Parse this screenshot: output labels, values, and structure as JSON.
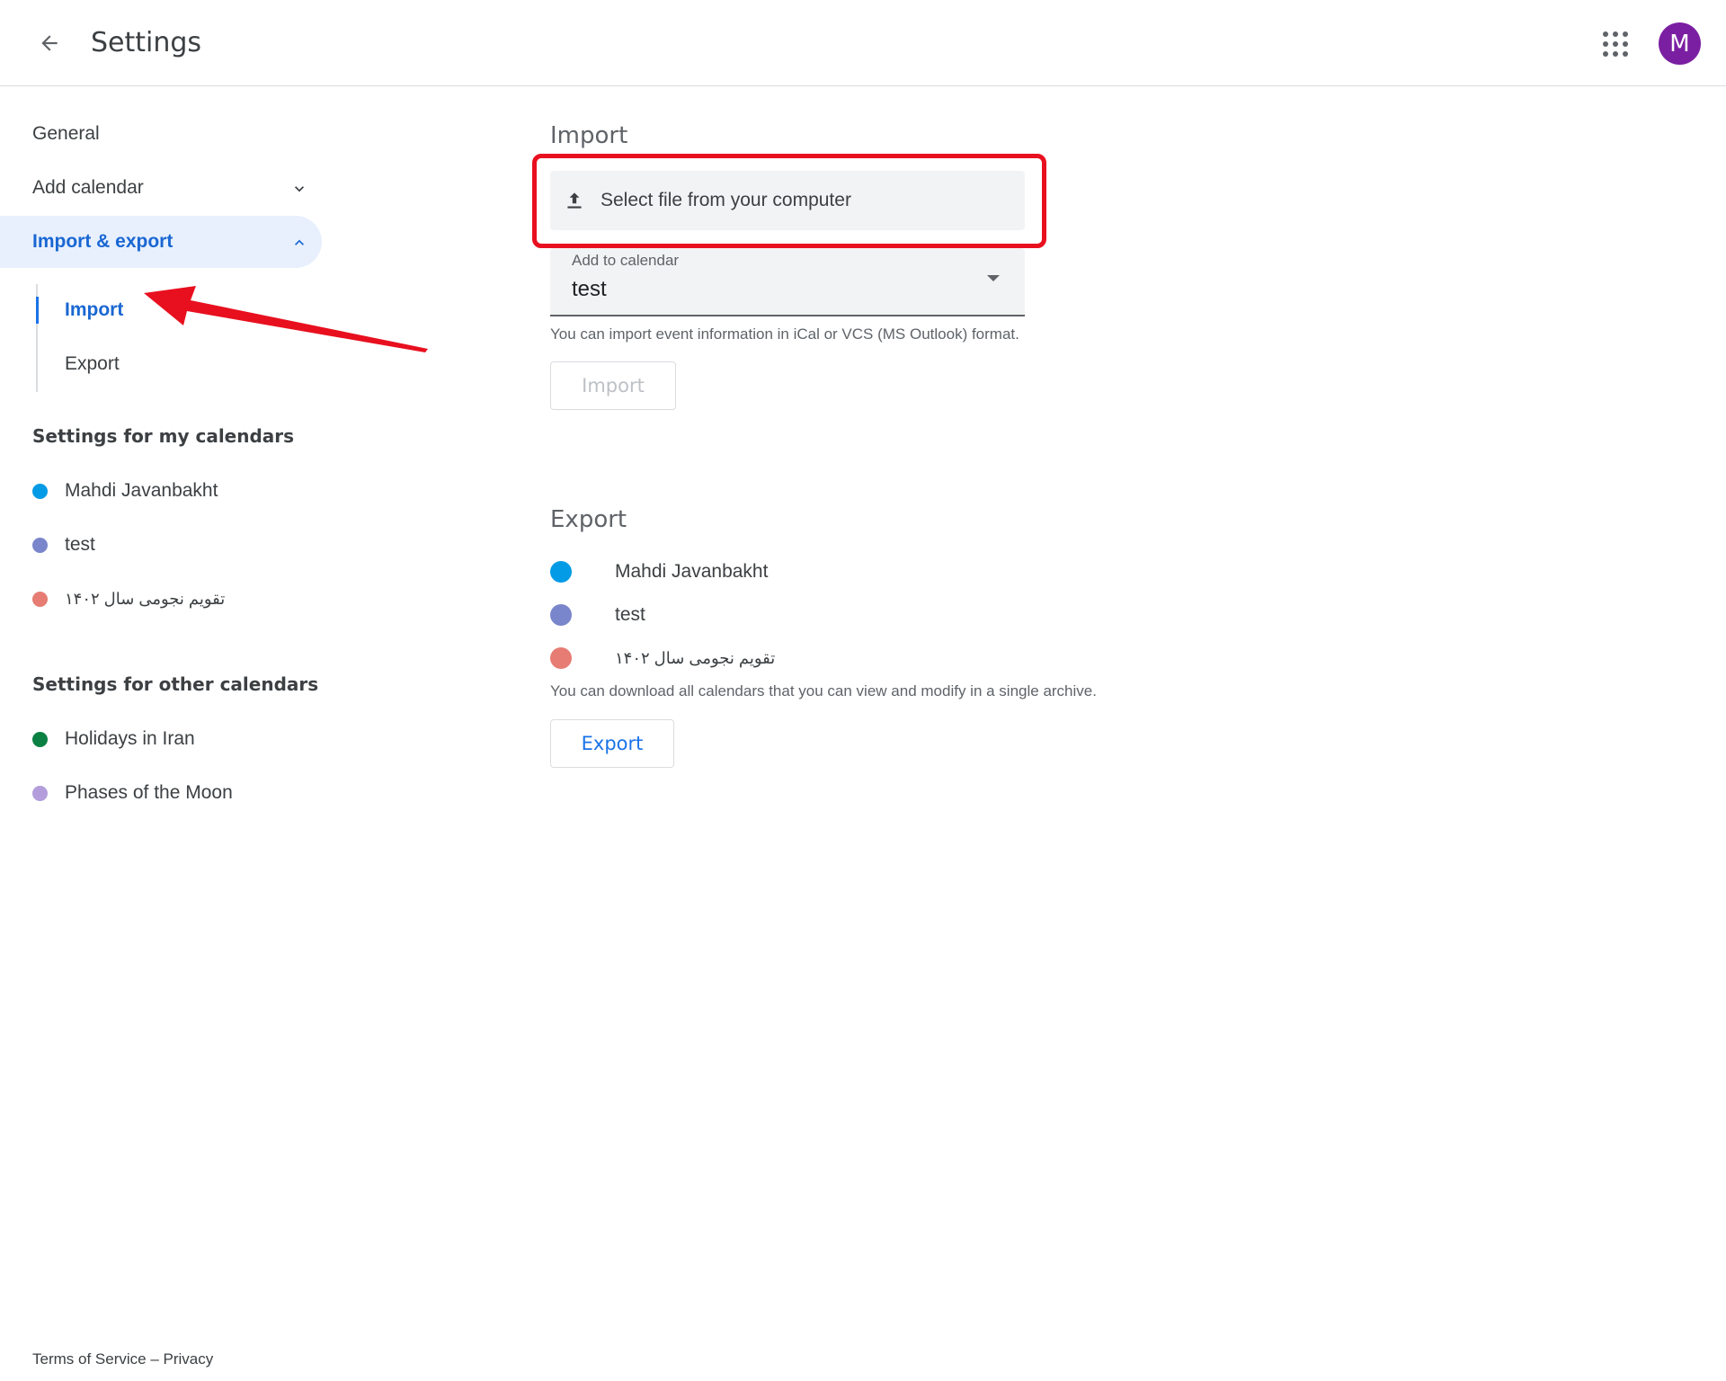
{
  "header": {
    "title": "Settings",
    "avatar_letter": "M",
    "avatar_color": "#7b1fa2",
    "back_icon": "arrow-back-icon",
    "apps_icon": "apps-grid-icon"
  },
  "sidebar": {
    "nav": {
      "general": "General",
      "add_calendar": "Add calendar",
      "import_export": "Import & export"
    },
    "sub": {
      "import": "Import",
      "export": "Export"
    },
    "my_calendars_title": "Settings for my calendars",
    "my_calendars": [
      {
        "name": "Mahdi Javanbakht",
        "color": "#039be5"
      },
      {
        "name": "test",
        "color": "#7986cb"
      },
      {
        "name": "تقویم نجومی سال ۱۴۰۲",
        "color": "#e67c73"
      }
    ],
    "other_calendars_title": "Settings for other calendars",
    "other_calendars": [
      {
        "name": "Holidays in Iran",
        "color": "#0b8043"
      },
      {
        "name": "Phases of the Moon",
        "color": "#b39ddb"
      }
    ]
  },
  "import_section": {
    "heading": "Import",
    "file_button_label": "Select file from your computer",
    "add_to_calendar_label": "Add to calendar",
    "add_to_calendar_value": "test",
    "hint": "You can import event information in iCal or VCS (MS Outlook) format.",
    "import_button": "Import"
  },
  "export_section": {
    "heading": "Export",
    "calendars": [
      {
        "name": "Mahdi Javanbakht",
        "color": "#039be5"
      },
      {
        "name": "test",
        "color": "#7986cb"
      },
      {
        "name": "تقویم نجومی سال ۱۴۰۲",
        "color": "#e67c73"
      }
    ],
    "hint": "You can download all calendars that you can view and modify in a single archive.",
    "export_button": "Export"
  },
  "footer": {
    "terms": "Terms of Service",
    "separator": "–",
    "privacy": "Privacy"
  },
  "annotation": {
    "highlight_color": "#e8101f"
  }
}
